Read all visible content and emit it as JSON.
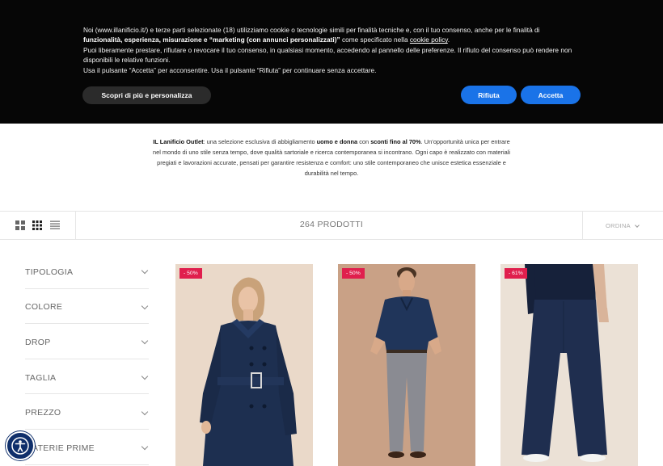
{
  "cookie_banner": {
    "line1_start": "Noi (www.illanificio.it/) e terze parti selezionate (18) utilizziamo cookie o tecnologie simili per finalità tecniche e, con il tuo consenso, anche per le finalità di",
    "line2_bold": "funzionalità, esperienza, misurazione e “marketing (con annunci personalizzati)”",
    "line2_rest": " come specificato nella ",
    "cookie_policy_link": "cookie policy",
    "line2_end": ".",
    "line3": "Puoi liberamente prestare, rifiutare o revocare il tuo consenso, in qualsiasi momento, accedendo al pannello delle preferenze. Il rifiuto del consenso può rendere non disponibili le relative funzioni.",
    "line4": "Usa il pulsante “Accetta” per acconsentire. Usa il pulsante “Rifiuta” per continuare senza accettare.",
    "more_button": "Scopri di più e personalizza",
    "reject_button": "Rifiuta",
    "accept_button": "Accetta"
  },
  "intro": {
    "brand_bold": "IL Lanificio Outlet",
    "part1": ": una selezione esclusiva di abbigliamento ",
    "bold2": "uomo e donna",
    "part2": " con ",
    "bold3": "sconti fino al 70%",
    "part3": ". Un’opportunità unica per entrare nel mondo di uno stile senza tempo, dove qualità sartoriale e ricerca contemporanea si incontrano. Ogni capo è realizzato con materiali pregiati e lavorazioni accurate, pensati per garantire resistenza e comfort: uno stile contemporaneo che unisce estetica essenziale e durabilità nel tempo."
  },
  "toolbar": {
    "product_count": "264 PRODOTTI",
    "sort_label": "ORDINA",
    "views": [
      "grid-2-icon",
      "grid-3-icon",
      "list-icon"
    ]
  },
  "filters": [
    {
      "label": "TIPOLOGIA"
    },
    {
      "label": "COLORE"
    },
    {
      "label": "DROP"
    },
    {
      "label": "TAGLIA"
    },
    {
      "label": "PREZZO"
    },
    {
      "label": "MATERIE PRIME"
    }
  ],
  "products": [
    {
      "discount": "- 50%"
    },
    {
      "discount": "- 50%"
    },
    {
      "discount": "- 61%"
    }
  ],
  "colors": {
    "accent_blue": "#1a73e8",
    "badge_red": "#e01f4d",
    "banner_bg": "#060606"
  }
}
